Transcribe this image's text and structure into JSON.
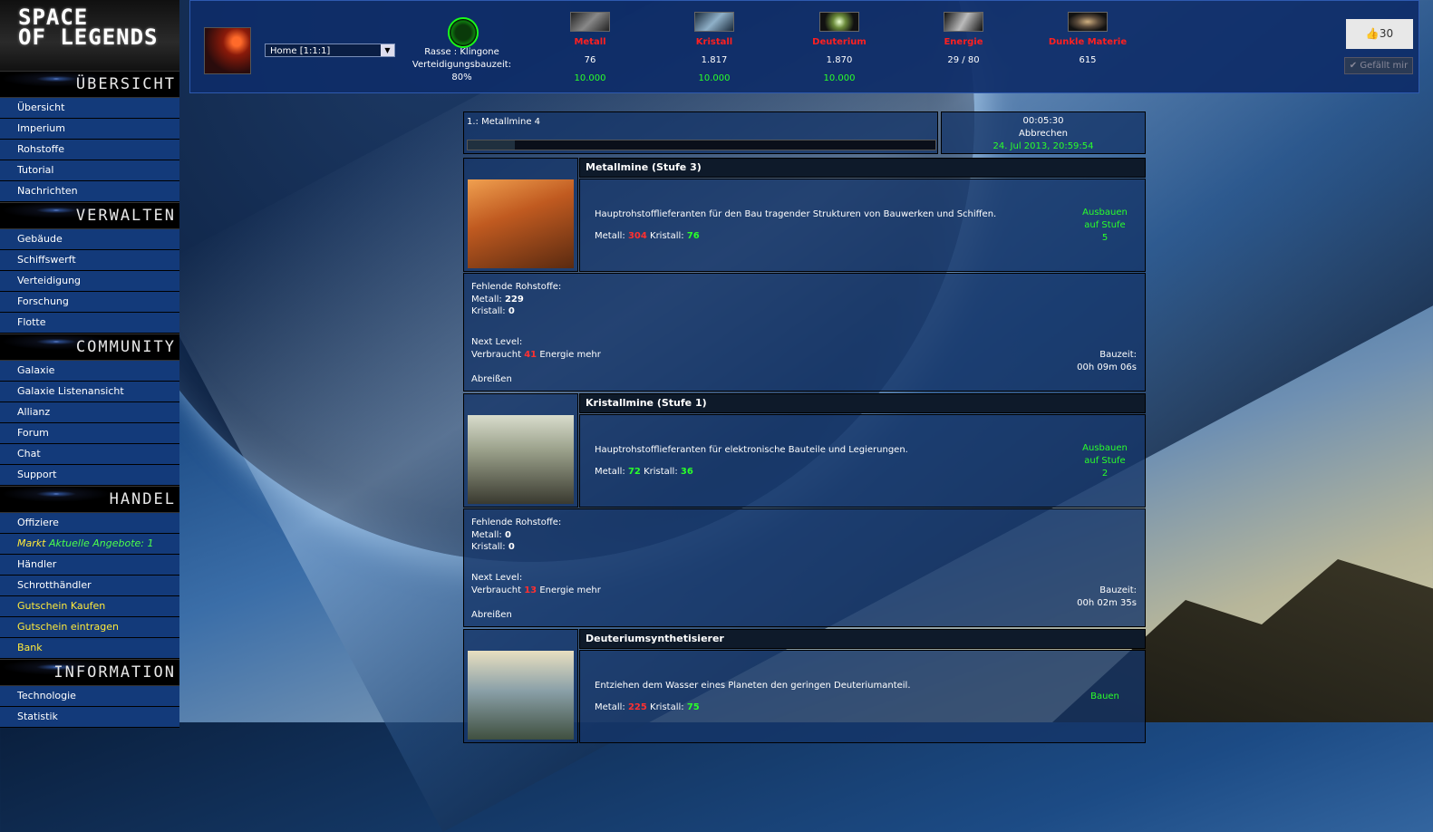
{
  "logo": {
    "line1": "SPACE",
    "line2": "OF LEGENDS"
  },
  "sidebar": [
    {
      "title": "Übersicht",
      "items": [
        {
          "label": "Übersicht"
        },
        {
          "label": "Imperium"
        },
        {
          "label": "Rohstoffe"
        },
        {
          "label": "Tutorial"
        },
        {
          "label": "Nachrichten"
        }
      ]
    },
    {
      "title": "Verwalten",
      "items": [
        {
          "label": "Gebäude"
        },
        {
          "label": "Schiffswerft"
        },
        {
          "label": "Verteidigung"
        },
        {
          "label": "Forschung"
        },
        {
          "label": "Flotte"
        }
      ]
    },
    {
      "title": "Community",
      "items": [
        {
          "label": "Galaxie"
        },
        {
          "label": "Galaxie Listenansicht"
        },
        {
          "label": "Allianz"
        },
        {
          "label": "Forum"
        },
        {
          "label": "Chat"
        },
        {
          "label": "Support"
        }
      ]
    },
    {
      "title": "Handel",
      "items": [
        {
          "label": "Offiziere"
        },
        {
          "label": "Markt",
          "extra": "Aktuelle Angebote: 1"
        },
        {
          "label": "Händler"
        },
        {
          "label": "Schrotthändler"
        },
        {
          "label": "Gutschein Kaufen",
          "color": "yellow"
        },
        {
          "label": "Gutschein eintragen",
          "color": "yellow"
        },
        {
          "label": "Bank",
          "color": "yellow"
        }
      ]
    },
    {
      "title": "Information",
      "items": [
        {
          "label": "Technologie"
        },
        {
          "label": "Statistik"
        }
      ]
    }
  ],
  "header": {
    "planet_select": "Home [1:1:1]",
    "race_line": "Rasse : Klingone",
    "defense_label": "Verteidigungsbauzeit:",
    "defense_value": "80%",
    "resources": [
      {
        "name": "Metall",
        "value": "76",
        "max": "10.000",
        "icon": "metal-icon"
      },
      {
        "name": "Kristall",
        "value": "1.817",
        "max": "10.000",
        "icon": "crystal-icon"
      },
      {
        "name": "Deuterium",
        "value": "1.870",
        "max": "10.000",
        "icon": "deuterium-icon"
      },
      {
        "name": "Energie",
        "value": "29 / 80",
        "max": "",
        "icon": "energy-icon"
      },
      {
        "name": "Dunkle Materie",
        "value": "615",
        "max": "",
        "icon": "dark-matter-icon"
      }
    ],
    "like_count": "30",
    "like_label": "✔ Gefällt mir"
  },
  "queue": {
    "item": "1.: Metallmine 4",
    "progress": 0.1,
    "time_left": "00:05:30",
    "cancel": "Abbrechen",
    "finish": "24. Jul 2013, 20:59:54"
  },
  "buildings": [
    {
      "title": "Metallmine (Stufe 3)",
      "desc": "Hauptrohstofflieferanten für den Bau tragender Strukturen von Bauwerken und Schiffen.",
      "metal_label": "Metall:",
      "metal": "304",
      "metal_ok": false,
      "crystal_label": "Kristall:",
      "crystal": "76",
      "crystal_ok": true,
      "action1": "Ausbauen",
      "action2": "auf Stufe",
      "action3": "5",
      "missing_label": "Fehlende Rohstoffe:",
      "missing_metal": "229",
      "missing_crystal": "0",
      "next_level": "Next Level:",
      "energy_pre": "Verbraucht",
      "energy": "41",
      "energy_post": "Energie mehr",
      "build_label": "Bauzeit:",
      "build_time": "00h 09m 06s",
      "demolish": "Abreißen"
    },
    {
      "title": "Kristallmine (Stufe 1)",
      "desc": "Hauptrohstofflieferanten für elektronische Bauteile und Legierungen.",
      "metal_label": "Metall:",
      "metal": "72",
      "metal_ok": true,
      "crystal_label": "Kristall:",
      "crystal": "36",
      "crystal_ok": true,
      "action1": "Ausbauen",
      "action2": "auf Stufe",
      "action3": "2",
      "missing_label": "Fehlende Rohstoffe:",
      "missing_metal": "0",
      "missing_crystal": "0",
      "next_level": "Next Level:",
      "energy_pre": "Verbraucht",
      "energy": "13",
      "energy_post": "Energie mehr",
      "build_label": "Bauzeit:",
      "build_time": "00h 02m 35s",
      "demolish": "Abreißen"
    },
    {
      "title": "Deuteriumsynthetisierer",
      "desc": "Entziehen dem Wasser eines Planeten den geringen Deuteriumanteil.",
      "metal_label": "Metall:",
      "metal": "225",
      "metal_ok": false,
      "crystal_label": "Kristall:",
      "crystal": "75",
      "crystal_ok": true,
      "action1": "Bauen"
    }
  ]
}
